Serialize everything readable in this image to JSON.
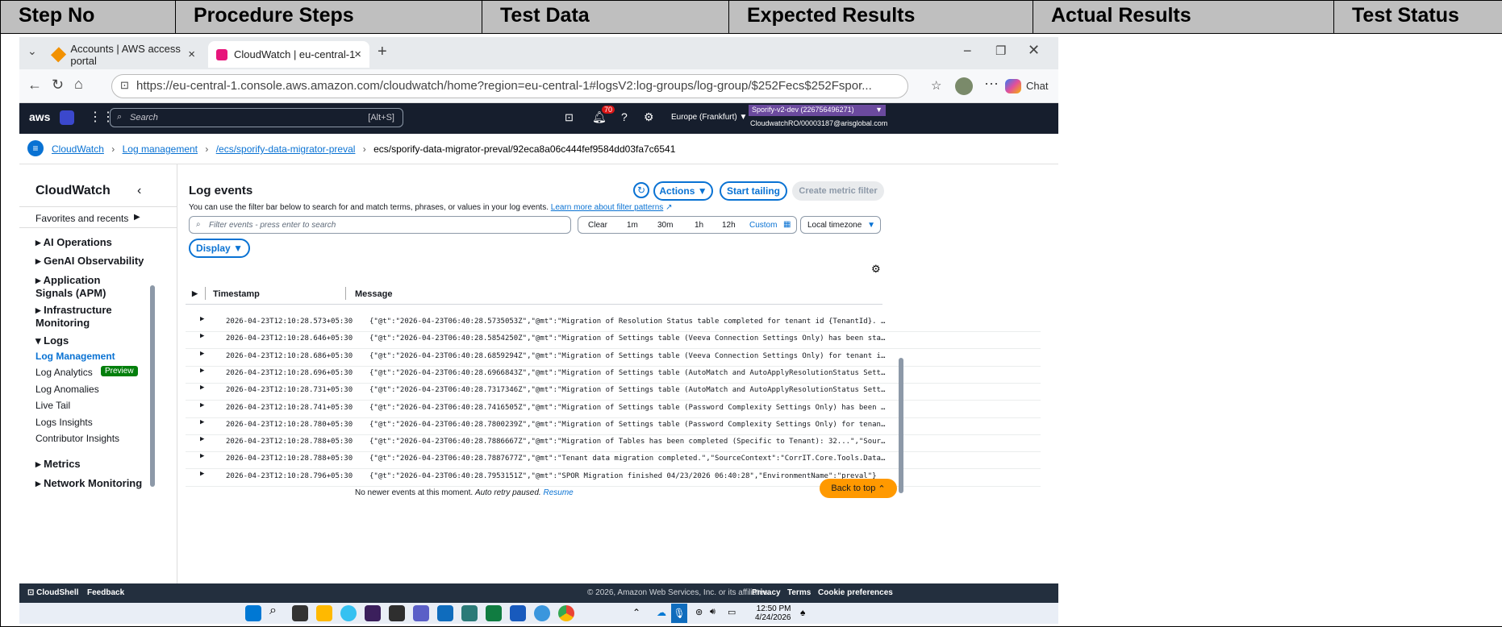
{
  "table": {
    "headers": [
      "Step No",
      "Procedure Steps",
      "Test Data",
      "Expected Results",
      "Actual Results",
      "Test Status"
    ]
  },
  "browser": {
    "tabs": [
      {
        "label": "Accounts | AWS access portal"
      },
      {
        "label": "CloudWatch | eu-central-1"
      }
    ],
    "url": "https://eu-central-1.console.aws.amazon.com/cloudwatch/home?region=eu-central-1#logsV2:log-groups/log-group/$252Fecs$252Fspor...",
    "chat_label": "Chat"
  },
  "aws": {
    "logo": "aws",
    "search_placeholder": "Search",
    "shortcut": "[Alt+S]",
    "notif_count": "70",
    "region": "Europe (Frankfurt)",
    "account": "Sporify-v2-dev (226756496271)",
    "user": "CloudwatchRO/00003187@arisglobal.com"
  },
  "breadcrumb": {
    "items": [
      "CloudWatch",
      "Log management",
      "/ecs/sporify-data-migrator-preval"
    ],
    "current": "ecs/sporify-data-migrator-preval/92eca8a06c444fef9584dd03fa7c6541"
  },
  "sidebar": {
    "title": "CloudWatch",
    "favorites": "Favorites and recents",
    "items": [
      "AI Operations",
      "GenAI Observability",
      "Application Signals (APM)",
      "Infrastructure Monitoring",
      "Logs"
    ],
    "logs_sub": [
      "Log Management",
      "Log Analytics",
      "Log Anomalies",
      "Live Tail",
      "Logs Insights",
      "Contributor Insights"
    ],
    "preview_badge": "Preview",
    "bottom": [
      "Metrics",
      "Network Monitoring"
    ]
  },
  "main": {
    "title": "Log events",
    "actions": "Actions",
    "start_tailing": "Start tailing",
    "create_metric": "Create metric filter",
    "description": "You can use the filter bar below to search for and match terms, phrases, or values in your log events.",
    "learn_more": "Learn more about filter patterns",
    "filter_placeholder": "Filter events - press enter to search",
    "time_options": [
      "Clear",
      "1m",
      "30m",
      "1h",
      "12h",
      "Custom"
    ],
    "timezone": "Local timezone",
    "display": "Display",
    "col_timestamp": "Timestamp",
    "col_message": "Message",
    "rows": [
      {
        "ts": "2026-04-23T12:10:28.573+05:30",
        "msg": "{\"@t\":\"2026-04-23T06:40:28.5735053Z\",\"@mt\":\"Migration of Resolution Status table completed for tenant id {TenantId}. Records migrated: {Cou…"
      },
      {
        "ts": "2026-04-23T12:10:28.646+05:30",
        "msg": "{\"@t\":\"2026-04-23T06:40:28.5854250Z\",\"@mt\":\"Migration of Settings table (Veeva Connection Settings Only) has been started for tenant id: 32…"
      },
      {
        "ts": "2026-04-23T12:10:28.686+05:30",
        "msg": "{\"@t\":\"2026-04-23T06:40:28.6859294Z\",\"@mt\":\"Migration of Settings table (Veeva Connection Settings Only) for tenant id {TenantId}. Records …"
      },
      {
        "ts": "2026-04-23T12:10:28.696+05:30",
        "msg": "{\"@t\":\"2026-04-23T06:40:28.6966843Z\",\"@mt\":\"Migration of Settings table (AutoMatch and AutoApplyResolutionStatus Settings Only) has been st…"
      },
      {
        "ts": "2026-04-23T12:10:28.731+05:30",
        "msg": "{\"@t\":\"2026-04-23T06:40:28.7317346Z\",\"@mt\":\"Migration of Settings table (AutoMatch and AutoApplyResolutionStatus Settings Only) for tenant …"
      },
      {
        "ts": "2026-04-23T12:10:28.741+05:30",
        "msg": "{\"@t\":\"2026-04-23T06:40:28.7416505Z\",\"@mt\":\"Migration of Settings table (Password Complexity Settings Only) has been started for tenant id:…"
      },
      {
        "ts": "2026-04-23T12:10:28.780+05:30",
        "msg": "{\"@t\":\"2026-04-23T06:40:28.7800239Z\",\"@mt\":\"Migration of Settings table (Password Complexity Settings Only) for tenant id {TenantId}. Recor…"
      },
      {
        "ts": "2026-04-23T12:10:28.788+05:30",
        "msg": "{\"@t\":\"2026-04-23T06:40:28.7886667Z\",\"@mt\":\"Migration of Tables has been completed (Specific to Tenant): 32...\",\"SourceContext\":\"CorrIT.Cor…"
      },
      {
        "ts": "2026-04-23T12:10:28.788+05:30",
        "msg": "{\"@t\":\"2026-04-23T06:40:28.7887677Z\",\"@mt\":\"Tenant data migration completed.\",\"SourceContext\":\"CorrIT.Core.Tools.Data.Migrator.MigrateWorke…"
      },
      {
        "ts": "2026-04-23T12:10:28.796+05:30",
        "msg": "{\"@t\":\"2026-04-23T06:40:28.7953151Z\",\"@mt\":\"SPOR Migration finished 04/23/2026 06:40:28\",\"EnvironmentName\":\"preval\"}"
      }
    ],
    "no_newer": "No newer events at this moment.",
    "auto_retry": "Auto retry paused.",
    "resume": "Resume",
    "back_to_top": "Back to top"
  },
  "footer": {
    "cloudshell": "CloudShell",
    "feedback": "Feedback",
    "copyright": "© 2026, Amazon Web Services, Inc. or its affiliates.",
    "privacy": "Privacy",
    "terms": "Terms",
    "cookies": "Cookie preferences"
  },
  "taskbar": {
    "time": "12:50 PM",
    "date": "4/24/2026"
  }
}
